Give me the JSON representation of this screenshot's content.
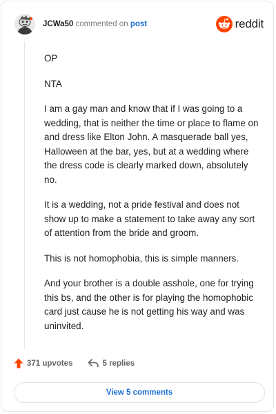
{
  "header": {
    "username": "JCWa50",
    "action_text": "commented on",
    "target_link": "post",
    "brand_name": "reddit",
    "brand_color": "#ff4500"
  },
  "comment": {
    "paragraphs": [
      "OP",
      "NTA",
      "I am a gay man and know that if I was going to a wedding, that is neither the time or place to flame on and dress like Elton John. A masquerade ball yes, Halloween at the bar, yes, but at a wedding where the dress code is clearly marked down, absolutely no.",
      "It is a wedding, not a pride festival and does not show up to make a statement to take away any sort of attention from the bride and groom.",
      "This is not homophobia, this is simple manners.",
      "And your brother is a double asshole, one for trying this bs, and the other is for playing the homophobic card just cause he is not getting his way and was uninvited."
    ]
  },
  "footer": {
    "upvotes_label": "371 upvotes",
    "replies_label": "5 replies",
    "view_button_label": "View 5 comments"
  },
  "colors": {
    "upvote_icon": "#ff4500",
    "link": "#1a6fd3"
  },
  "icons": {
    "avatar": "snoo-avatar",
    "brand": "reddit-logo-icon",
    "upvote": "upvote-arrow-icon",
    "reply": "reply-arrow-icon"
  }
}
